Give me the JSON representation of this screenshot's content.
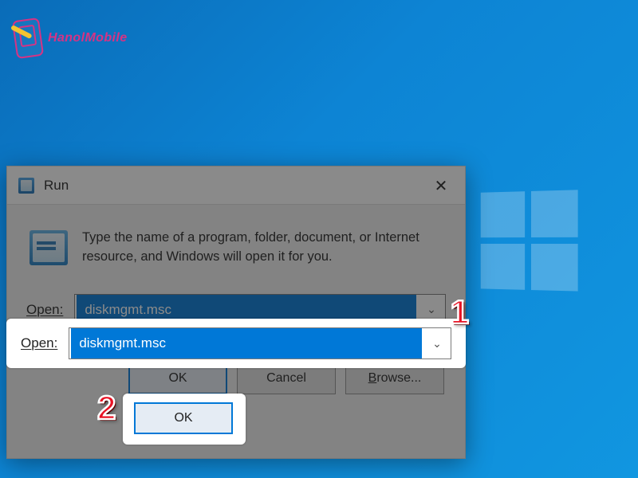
{
  "brand": {
    "name": "HanolMobile"
  },
  "run_dialog": {
    "title": "Run",
    "description": "Type the name of a program, folder, document, or Internet resource, and Windows will open it for you.",
    "open_label": "Open:",
    "open_value": "diskmgmt.msc",
    "buttons": {
      "ok": "OK",
      "cancel": "Cancel",
      "browse": "Browse..."
    }
  },
  "callouts": {
    "step1": "1",
    "step2": "2"
  }
}
